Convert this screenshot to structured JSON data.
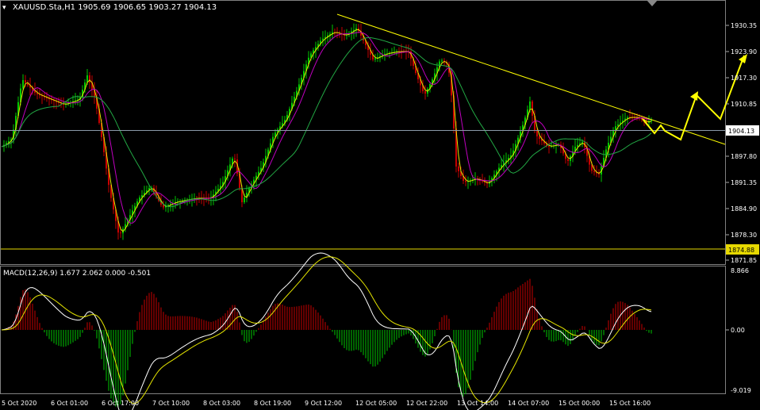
{
  "window": {
    "symbol_info": "XAUUSD.Sta,H1  1905.69 1906.65 1903.27 1904.13",
    "close_icon": "close-icon"
  },
  "price_panel": {
    "axis_labels": [
      "1930.35",
      "1923.90",
      "1917.30",
      "1910.85",
      "1897.80",
      "1891.35",
      "1884.90",
      "1878.30",
      "1871.85"
    ],
    "current_price": "1904.13",
    "support_level": "1874.88",
    "colors": {
      "bull": "#00c800",
      "bear": "#c80000",
      "ma_fast": "#e6e600",
      "ma_mid": "#c000c0",
      "ma_slow": "#22a844",
      "trendline": "#ffff00",
      "arrows": "#ffff00"
    }
  },
  "macd_panel": {
    "label": "MACD(12,26,9) 1.677 2.062 0.000 -0.501",
    "axis_labels": [
      "8.866",
      "0.00",
      "-9.019"
    ]
  },
  "time_axis": {
    "labels": [
      "5 Oct 2020",
      "6 Oct 01:00",
      "6 Oct 17:00",
      "7 Oct 10:00",
      "8 Oct 03:00",
      "8 Oct 19:00",
      "9 Oct 12:00",
      "12 Oct 05:00",
      "12 Oct 22:00",
      "13 Oct 14:00",
      "14 Oct 07:00",
      "15 Oct 00:00",
      "15 Oct 16:00"
    ]
  }
}
